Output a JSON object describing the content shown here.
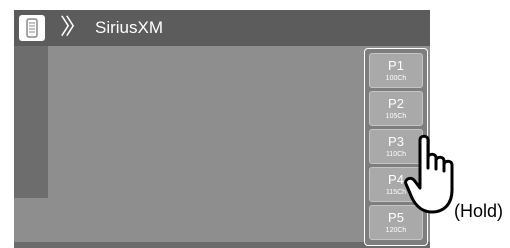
{
  "header": {
    "source_icon": "radio-source-icon",
    "chevron_icon": "double-chevron-icon",
    "title": "SiriusXM"
  },
  "presets": [
    {
      "label": "P1",
      "channel": "100Ch"
    },
    {
      "label": "P2",
      "channel": "105Ch"
    },
    {
      "label": "P3",
      "channel": "110Ch"
    },
    {
      "label": "P4",
      "channel": "115Ch"
    },
    {
      "label": "P5",
      "channel": "120Ch"
    }
  ],
  "annotation": {
    "gesture_icon": "tap-hand-icon",
    "hold_label": "(Hold)"
  },
  "colors": {
    "screen_background": "#8e8e8e",
    "topbar": "#5c5c5c",
    "preset_button": "#a9a9a9"
  }
}
